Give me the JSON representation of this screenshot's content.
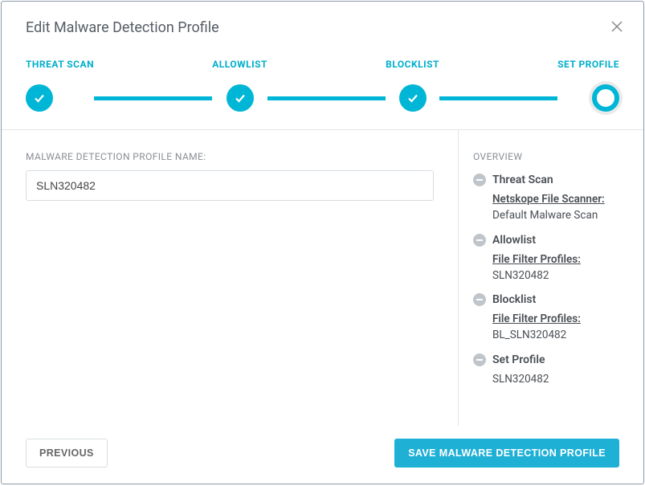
{
  "header": {
    "title": "Edit Malware Detection Profile"
  },
  "stepper": {
    "steps": [
      {
        "label": "THREAT SCAN",
        "state": "done"
      },
      {
        "label": "ALLOWLIST",
        "state": "done"
      },
      {
        "label": "BLOCKLIST",
        "state": "done"
      },
      {
        "label": "SET PROFILE",
        "state": "active"
      }
    ]
  },
  "form": {
    "profile_name_label": "MALWARE DETECTION PROFILE NAME:",
    "profile_name_value": "SLN320482"
  },
  "overview": {
    "title": "OVERVIEW",
    "sections": [
      {
        "title": "Threat Scan",
        "link_label": "Netskope File Scanner:",
        "value": "Default Malware Scan"
      },
      {
        "title": "Allowlist",
        "link_label": "File Filter Profiles:",
        "value": "SLN320482"
      },
      {
        "title": "Blocklist",
        "link_label": "File Filter Profiles:",
        "value": "BL_SLN320482"
      },
      {
        "title": "Set Profile",
        "link_label": "",
        "value": "SLN320482"
      }
    ]
  },
  "footer": {
    "previous_label": "PREVIOUS",
    "save_label": "SAVE MALWARE DETECTION PROFILE"
  }
}
